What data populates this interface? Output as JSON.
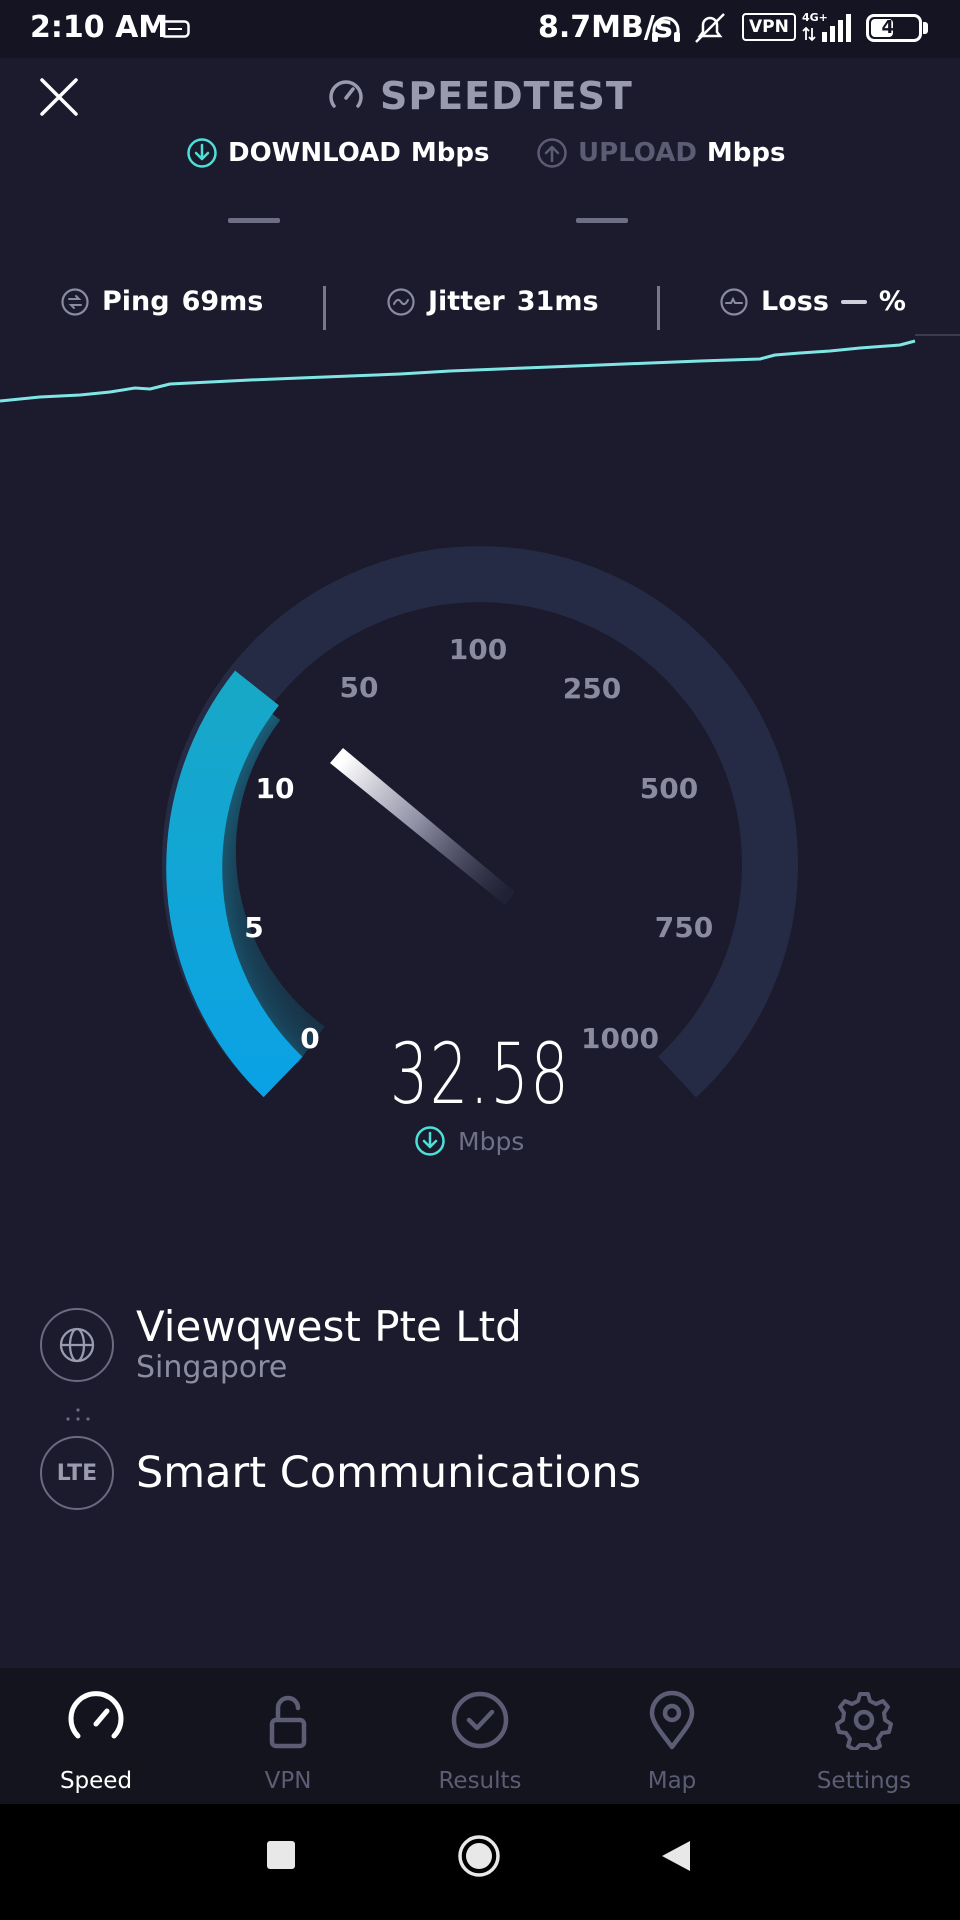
{
  "status_bar": {
    "time": "2:10 AM",
    "net_speed": "8.7MB/s",
    "vpn": "VPN",
    "network": "4G+",
    "battery": "42"
  },
  "header": {
    "title": "SPEEDTEST",
    "download_label": "DOWNLOAD",
    "download_unit": "Mbps",
    "upload_label": "UPLOAD",
    "upload_unit": "Mbps"
  },
  "metrics": {
    "ping_label": "Ping",
    "ping_value": "69ms",
    "jitter_label": "Jitter",
    "jitter_value": "31ms",
    "loss_label": "Loss",
    "loss_value": "%"
  },
  "gauge": {
    "ticks": [
      "0",
      "5",
      "10",
      "50",
      "100",
      "250",
      "500",
      "750",
      "1000"
    ],
    "value": "32.58",
    "unit": "Mbps",
    "accent": "#19b4e0"
  },
  "server": {
    "name": "Viewqwest Pte Ltd",
    "location": "Singapore"
  },
  "provider": {
    "type": "LTE",
    "name": "Smart Communications"
  },
  "nav": {
    "items": [
      {
        "label": "Speed",
        "icon": "speedometer-icon",
        "active": true
      },
      {
        "label": "VPN",
        "icon": "unlock-icon"
      },
      {
        "label": "Results",
        "icon": "check-circle-icon"
      },
      {
        "label": "Map",
        "icon": "map-pin-icon"
      },
      {
        "label": "Settings",
        "icon": "gear-icon"
      }
    ]
  },
  "colors": {
    "background": "#1b1b2d",
    "accent_line": "#7fe6e6",
    "accent_gauge": "#19b4e0"
  }
}
